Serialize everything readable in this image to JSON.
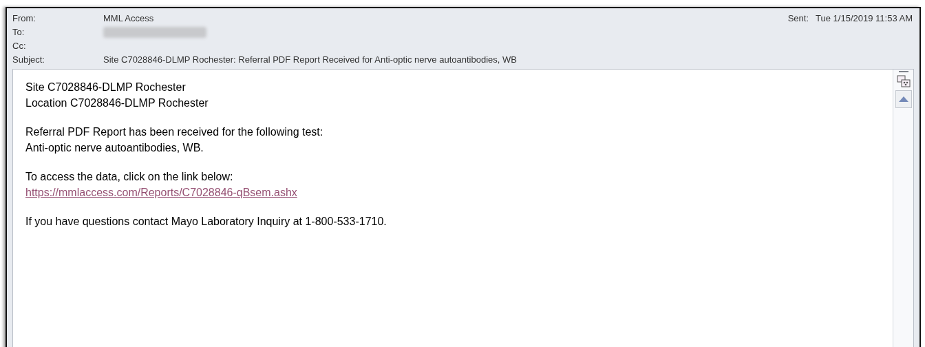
{
  "header": {
    "fields": [
      {
        "label": "From:",
        "value": "MML Access"
      },
      {
        "label": "To:",
        "redacted": true
      },
      {
        "label": "Cc:"
      },
      {
        "label": "Subject:",
        "value": "Site C7028846-DLMP Rochester: Referral PDF Report Received for Anti-optic nerve autoantibodies, WB"
      }
    ],
    "sent": {
      "label": "Sent:",
      "value": "Tue 1/15/2019 11:53 AM"
    }
  },
  "body": {
    "paragraphs": [
      [
        {
          "kind": "text",
          "text": "Site C7028846-DLMP Rochester"
        },
        {
          "kind": "text",
          "text": "Location C7028846-DLMP Rochester"
        }
      ],
      [
        {
          "kind": "text",
          "text": "Referral PDF Report has been received for the following test:"
        },
        {
          "kind": "text",
          "text": "Anti-optic nerve autoantibodies, WB."
        }
      ],
      [
        {
          "kind": "text",
          "text": "To access the data, click on the link below:"
        },
        {
          "kind": "link",
          "text": "https://mmlaccess.com/Reports/C7028846-qBsem.ashx"
        }
      ],
      [
        {
          "kind": "text",
          "text": "If you have questions contact Mayo Laboratory Inquiry at 1-800-533-1710."
        }
      ]
    ]
  }
}
